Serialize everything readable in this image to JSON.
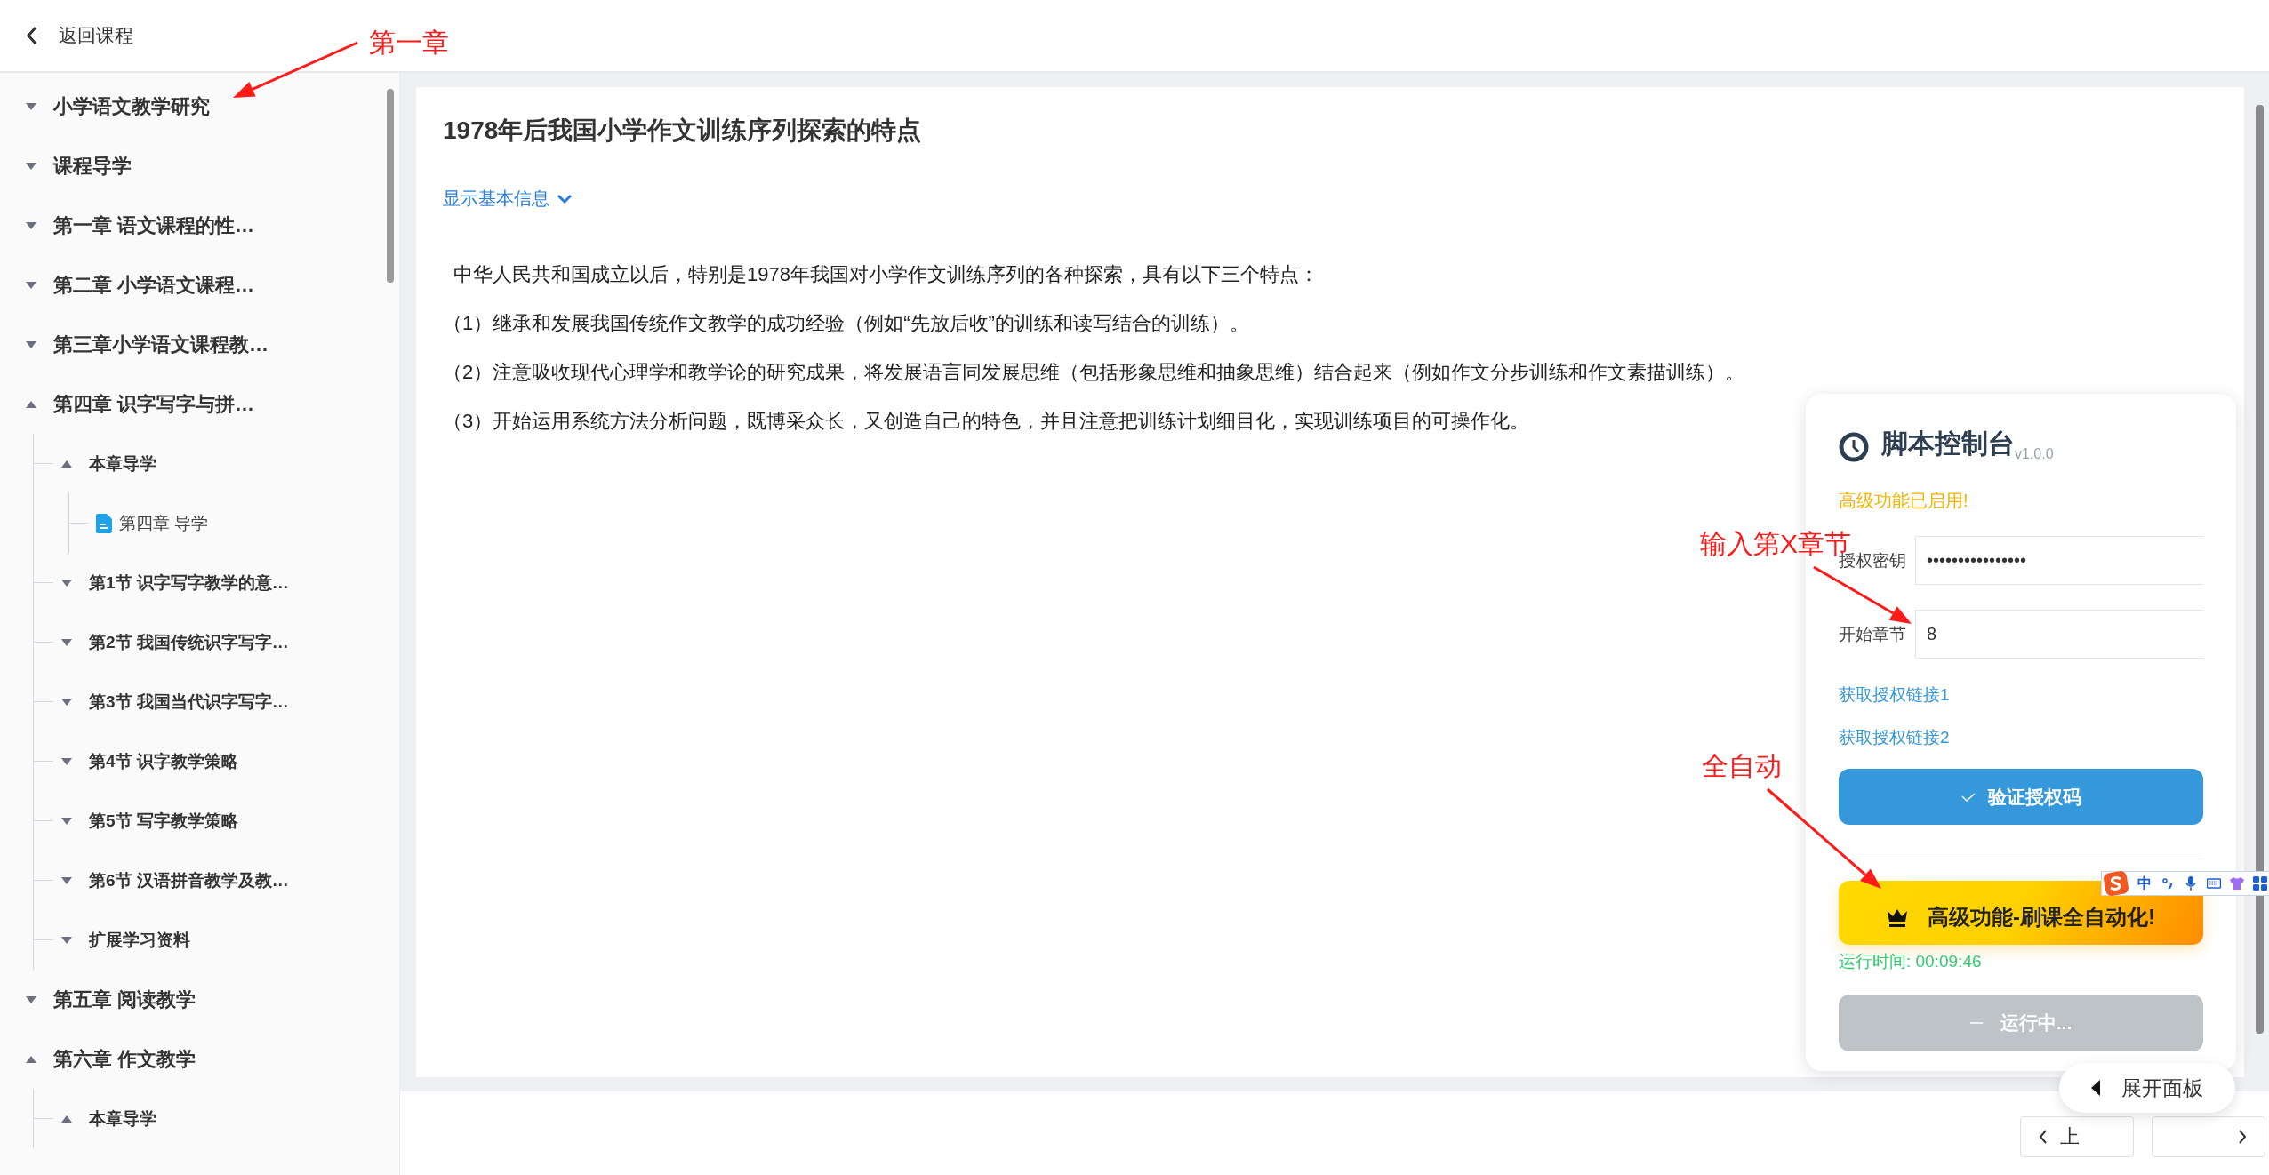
{
  "header": {
    "back_label": "返回课程"
  },
  "sidebar": {
    "tree": [
      {
        "label": "小学语文教学研究",
        "expanded": false
      },
      {
        "label": "课程导学",
        "expanded": false
      },
      {
        "label": "第一章 语文课程的性…",
        "expanded": false
      },
      {
        "label": "第二章 小学语文课程…",
        "expanded": false
      },
      {
        "label": "第三章小学语文课程教…",
        "expanded": false
      },
      {
        "label": "第四章 识字写字与拼…",
        "expanded": true,
        "children": [
          {
            "label": "本章导学",
            "expanded": true,
            "children": [
              {
                "label": "第四章 导学",
                "kind": "document"
              }
            ]
          },
          {
            "label": "第1节 识字写字教学的意…",
            "expanded": false
          },
          {
            "label": "第2节 我国传统识字写字…",
            "expanded": false
          },
          {
            "label": "第3节 我国当代识字写字…",
            "expanded": false
          },
          {
            "label": "第4节 识字教学策略",
            "expanded": false
          },
          {
            "label": "第5节 写字教学策略",
            "expanded": false
          },
          {
            "label": "第6节 汉语拼音教学及教…",
            "expanded": false
          },
          {
            "label": "扩展学习资料",
            "expanded": false
          }
        ]
      },
      {
        "label": "第五章 阅读教学",
        "expanded": false
      },
      {
        "label": "第六章 作文教学",
        "expanded": true,
        "children": [
          {
            "label": "本章导学",
            "expanded": true
          }
        ]
      }
    ]
  },
  "article": {
    "title": "1978年后我国小学作文训练序列探索的特点",
    "info_toggle": "显示基本信息",
    "paragraphs": [
      "中华人民共和国成立以后，特别是1978年我国对小学作文训练序列的各种探索，具有以下三个特点：",
      "（1）继承和发展我国传统作文教学的成功经验（例如“先放后收”的训练和读写结合的训练）。",
      "（2）注意吸收现代心理学和教学论的研究成果，将发展语言同发展思维（包括形象思维和抽象思维）结合起来（例如作文分步训练和作文素描训练）。",
      "（3）开始运用系统方法分析问题，既博采众长，又创造自己的特色，并且注意把训练计划细目化，实现训练项目的可操作化。"
    ]
  },
  "script_panel": {
    "title": "脚本控制台",
    "version": "v1.0.0",
    "status": "高级功能已启用!",
    "fields": [
      {
        "label": "授权密钥",
        "value": "••••••••••••••••"
      },
      {
        "label": "开始章节",
        "value": "8"
      }
    ],
    "links": [
      "获取授权链接1",
      "获取授权链接2"
    ],
    "verify_button": "验证授权码",
    "auto_button": "高级功能-刷课全自动化!",
    "run_time": "运行时间: 00:09:46",
    "run_button": {
      "label": "运行中...",
      "disabled": true
    }
  },
  "expand_panel_button": "展开面板",
  "pagination": {
    "prev_label": "上"
  },
  "ime_toolbar": {
    "mode": "中"
  },
  "annotations": [
    {
      "text": "第一章"
    },
    {
      "text": "输入第X章节"
    },
    {
      "text": "全自动"
    }
  ]
}
